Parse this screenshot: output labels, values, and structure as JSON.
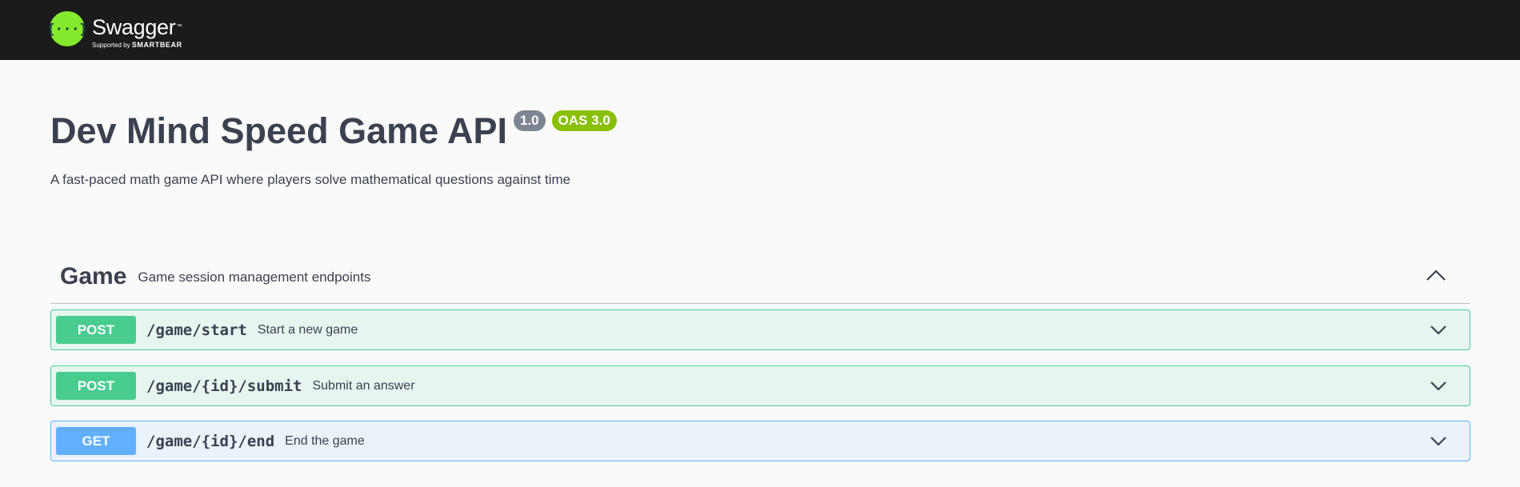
{
  "topbar": {
    "brand": "Swagger",
    "tm": "™",
    "supported_by": "Supported by",
    "smartbear": "SMARTBEAR",
    "logo_icon": "swagger-braces-icon",
    "logo_color": "#85ea2d"
  },
  "info": {
    "title": "Dev Mind Speed Game API",
    "version": "1.0",
    "oas": "OAS 3.0",
    "description": "A fast-paced math game API where players solve mathematical questions against time"
  },
  "tag": {
    "name": "Game",
    "description": "Game session management endpoints",
    "toggle_icon": "chevron-up-icon"
  },
  "operations": [
    {
      "method": "POST",
      "path": "/game/start",
      "summary": "Start a new game",
      "color": "#49cc90"
    },
    {
      "method": "POST",
      "path": "/game/{id}/submit",
      "summary": "Submit an answer",
      "color": "#49cc90"
    },
    {
      "method": "GET",
      "path": "/game/{id}/end",
      "summary": "End the game",
      "color": "#61affe"
    }
  ]
}
